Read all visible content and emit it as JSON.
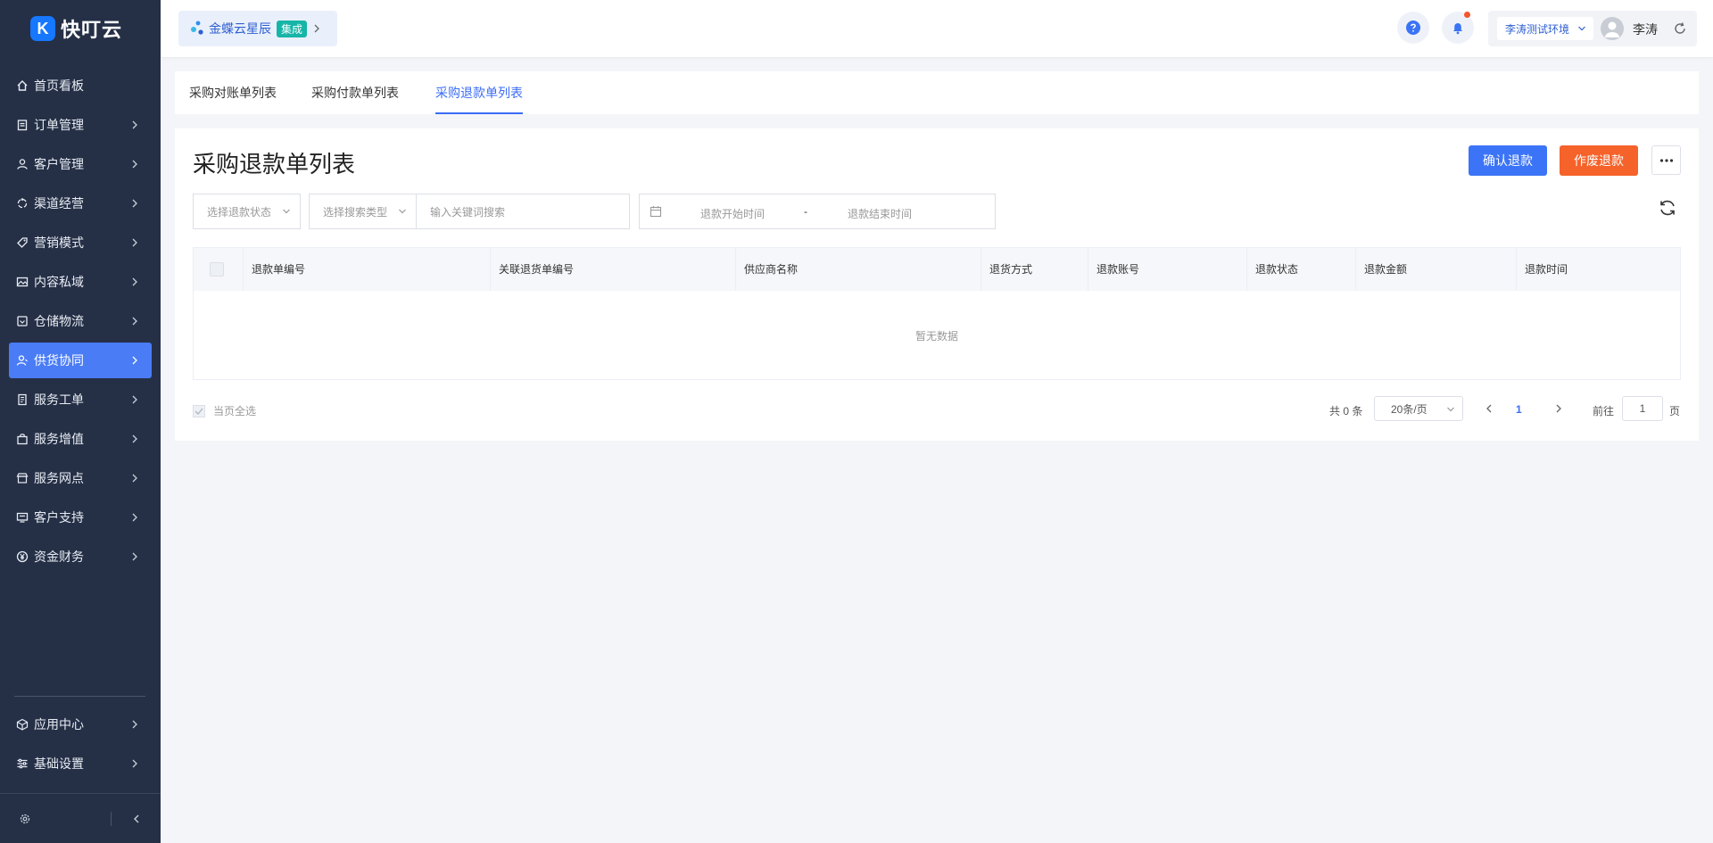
{
  "app": {
    "logo_letter": "K",
    "logo_text": "快叮云"
  },
  "header": {
    "integration_name": "金蝶云星辰",
    "integration_tag": "集成",
    "env_select": "李涛测试环境",
    "user_name": "李涛",
    "icons": [
      "help-icon",
      "bell-icon",
      "avatar",
      "refresh-icon"
    ]
  },
  "sidebar": {
    "items": [
      {
        "label": "首页看板",
        "icon": "home-icon",
        "has_children": false,
        "active": false
      },
      {
        "label": "订单管理",
        "icon": "clipboard-icon",
        "has_children": true,
        "active": false
      },
      {
        "label": "客户管理",
        "icon": "user-icon",
        "has_children": true,
        "active": false
      },
      {
        "label": "渠道经营",
        "icon": "channel-icon",
        "has_children": true,
        "active": false
      },
      {
        "label": "营销模式",
        "icon": "tag-icon",
        "has_children": true,
        "active": false
      },
      {
        "label": "内容私域",
        "icon": "image-icon",
        "has_children": true,
        "active": false
      },
      {
        "label": "仓储物流",
        "icon": "box-icon",
        "has_children": true,
        "active": false
      },
      {
        "label": "供货协同",
        "icon": "supply-user-icon",
        "has_children": true,
        "active": true
      },
      {
        "label": "服务工单",
        "icon": "ticket-icon",
        "has_children": true,
        "active": false
      },
      {
        "label": "服务增值",
        "icon": "bag-icon",
        "has_children": true,
        "active": false
      },
      {
        "label": "服务网点",
        "icon": "store-icon",
        "has_children": true,
        "active": false
      },
      {
        "label": "客户支持",
        "icon": "support-icon",
        "has_children": true,
        "active": false
      },
      {
        "label": "资金财务",
        "icon": "yen-icon",
        "has_children": true,
        "active": false
      }
    ],
    "bottom_items": [
      {
        "label": "应用中心",
        "icon": "cube-icon"
      },
      {
        "label": "基础设置",
        "icon": "sliders-icon"
      }
    ]
  },
  "tabs": [
    {
      "label": "采购对账单列表",
      "active": false
    },
    {
      "label": "采购付款单列表",
      "active": false
    },
    {
      "label": "采购退款单列表",
      "active": true
    }
  ],
  "main": {
    "title": "采购退款单列表",
    "confirm_button": "确认退款",
    "void_button": "作废退款",
    "filters": {
      "status_placeholder": "选择退款状态",
      "search_type_placeholder": "选择搜索类型",
      "keyword_placeholder": "输入关键词搜索",
      "start_placeholder": "退款开始时间",
      "range_separator": "-",
      "end_placeholder": "退款结束时间"
    },
    "table": {
      "columns": [
        "退款单编号",
        "关联退货单编号",
        "供应商名称",
        "退货方式",
        "退款账号",
        "退款状态",
        "退款金额",
        "退款时间"
      ],
      "rows": [],
      "empty_text": "暂无数据"
    },
    "footer": {
      "select_all": "当页全选",
      "total": "共 0 条",
      "page_size": "20条/页",
      "current_page": "1",
      "goto_label": "前往",
      "goto_value": "1",
      "goto_suffix": "页"
    }
  },
  "colors": {
    "sidebar_bg": "#253047",
    "accent": "#3b74f6",
    "danger": "#f5622a",
    "active_nav": "#4a7cf6"
  }
}
